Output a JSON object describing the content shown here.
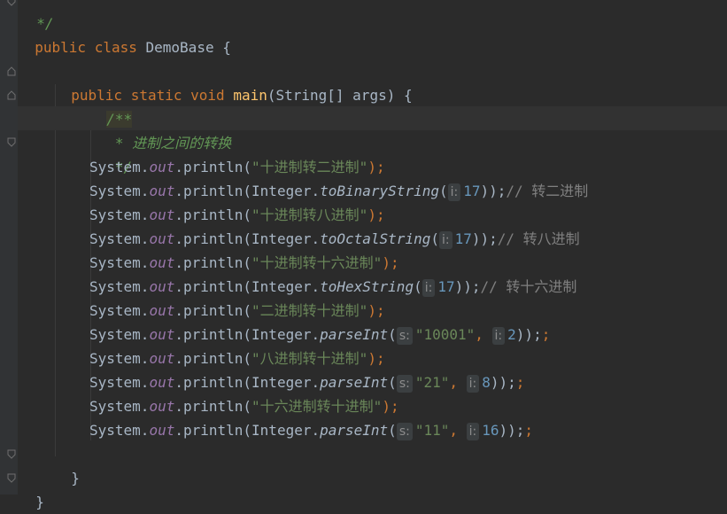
{
  "editor": {
    "theme_colors": {
      "background": "#2b2b2b",
      "keyword": "#cc7832",
      "method": "#ffc66d",
      "string": "#6a8759",
      "number": "#6897bb",
      "field": "#9876aa",
      "doc_comment": "#629755",
      "comment": "#808080",
      "text": "#a9b7c6"
    },
    "top_line": "*/",
    "class_decl": {
      "kw1": "public",
      "kw2": "class",
      "name": "DemoBase",
      "brace": " {"
    },
    "main_decl": {
      "kw1": "public",
      "kw2": "static",
      "kw3": "void",
      "name": "main",
      "params": "(String[] args) {"
    },
    "doc": {
      "open": "/**",
      "body": " * 进制之间的转换",
      "close": " */"
    },
    "lines": [
      {
        "prefix": "System.",
        "field": "out",
        "call": ".println(",
        "str": "\"十进制转二进制\"",
        "end": ");"
      },
      {
        "prefix": "System.",
        "field": "out",
        "call": ".println(Integer.",
        "method": "toBinaryString",
        "hint": "i:",
        "num": "17",
        "end": "));",
        "comment": "// 转二进制"
      },
      {
        "prefix": "System.",
        "field": "out",
        "call": ".println(",
        "str": "\"十进制转八进制\"",
        "end": ");"
      },
      {
        "prefix": "System.",
        "field": "out",
        "call": ".println(Integer.",
        "method": "toOctalString",
        "hint": "i:",
        "num": "17",
        "end": "));",
        "comment": "// 转八进制"
      },
      {
        "prefix": "System.",
        "field": "out",
        "call": ".println(",
        "str": "\"十进制转十六进制\"",
        "end": ");"
      },
      {
        "prefix": "System.",
        "field": "out",
        "call": ".println(Integer.",
        "method": "toHexString",
        "hint": "i:",
        "num": "17",
        "end": "));",
        "comment": "// 转十六进制"
      },
      {
        "prefix": "System.",
        "field": "out",
        "call": ".println(",
        "str": "\"二进制转十进制\"",
        "end": ");"
      },
      {
        "prefix": "System.",
        "field": "out",
        "call": ".println(Integer.",
        "method": "parseInt",
        "hint_s": "s:",
        "sarg": "\"10001\"",
        "hint": "i:",
        "num": "2",
        "end": "));"
      },
      {
        "prefix": "System.",
        "field": "out",
        "call": ".println(",
        "str": "\"八进制转十进制\"",
        "end": ");"
      },
      {
        "prefix": "System.",
        "field": "out",
        "call": ".println(Integer.",
        "method": "parseInt",
        "hint_s": "s:",
        "sarg": "\"21\"",
        "hint": "i:",
        "num": "8",
        "end": "));"
      },
      {
        "prefix": "System.",
        "field": "out",
        "call": ".println(",
        "str": "\"十六进制转十进制\"",
        "end": ");"
      },
      {
        "prefix": "System.",
        "field": "out",
        "call": ".println(Integer.",
        "method": "parseInt",
        "hint_s": "s:",
        "sarg": "\"11\"",
        "hint": "i:",
        "num": "16",
        "end": "));"
      }
    ],
    "close_main": "}",
    "close_class": "}"
  }
}
